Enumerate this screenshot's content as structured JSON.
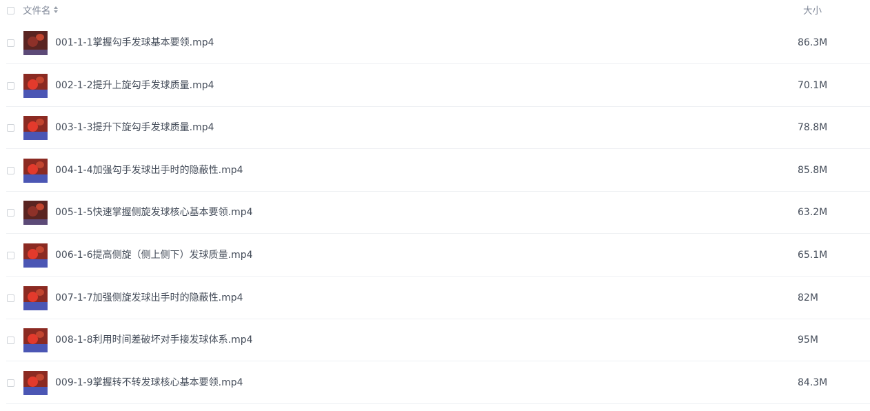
{
  "header": {
    "name_label": "文件名",
    "size_label": "大小"
  },
  "files": [
    {
      "name": "001-1-1掌握勾手发球基本要领.mp4",
      "size": "86.3M",
      "thumb_icon": "video-thumbnail-icon"
    },
    {
      "name": "002-1-2提升上旋勾手发球质量.mp4",
      "size": "70.1M",
      "thumb_icon": "video-thumbnail-icon"
    },
    {
      "name": "003-1-3提升下旋勾手发球质量.mp4",
      "size": "78.8M",
      "thumb_icon": "video-thumbnail-icon"
    },
    {
      "name": "004-1-4加强勾手发球出手时的隐蔽性.mp4",
      "size": "85.8M",
      "thumb_icon": "video-thumbnail-icon"
    },
    {
      "name": "005-1-5快速掌握侧旋发球核心基本要领.mp4",
      "size": "63.2M",
      "thumb_icon": "video-thumbnail-icon"
    },
    {
      "name": "006-1-6提高侧旋（侧上侧下）发球质量.mp4",
      "size": "65.1M",
      "thumb_icon": "video-thumbnail-icon"
    },
    {
      "name": "007-1-7加强侧旋发球出手时的隐蔽性.mp4",
      "size": "82M",
      "thumb_icon": "video-thumbnail-icon"
    },
    {
      "name": "008-1-8利用时间差破坏对手接发球体系.mp4",
      "size": "95M",
      "thumb_icon": "video-thumbnail-icon"
    },
    {
      "name": "009-1-9掌握转不转发球核心基本要领.mp4",
      "size": "84.3M",
      "thumb_icon": "video-thumbnail-icon"
    }
  ],
  "colors": {
    "text": "#454d5a",
    "header_text": "#818999",
    "divider": "#eef0f3",
    "checkbox_border": "#cfd3d8"
  }
}
